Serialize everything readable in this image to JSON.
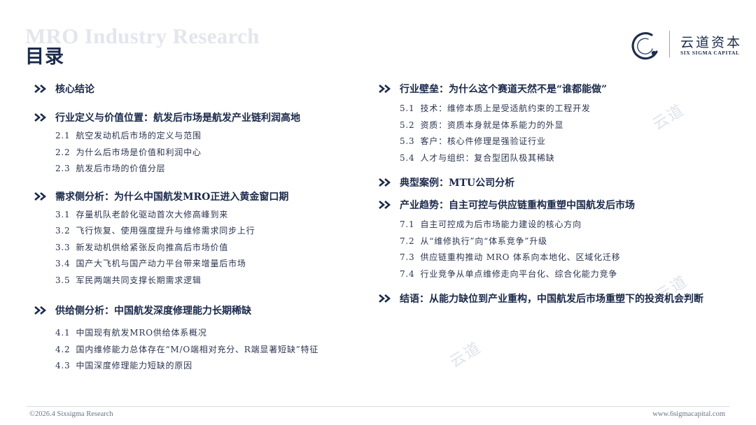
{
  "header": {
    "watermark_title": "MRO Industry Research",
    "title": "目录"
  },
  "logo": {
    "name_cn": "云道资本",
    "name_en": "SIX SIGMA CAPITAL",
    "brand_color": "#1f2d4d",
    "mark_icon": "ring-logo-icon"
  },
  "left_sections": [
    {
      "title": "核心结论",
      "items": []
    },
    {
      "title": "行业定义与价值位置：航发后市场是航发产业链利润高地",
      "items": [
        {
          "num": "2.1",
          "text": "航空发动机后市场的定义与范围"
        },
        {
          "num": "2.2",
          "text": "为什么后市场是价值和利润中心"
        },
        {
          "num": "2.3",
          "text": "航发后市场的价值分层"
        }
      ]
    },
    {
      "title": "需求侧分析：为什么中国航发MRO正进入黄金窗口期",
      "items": [
        {
          "num": "3.1",
          "text": "存量机队老龄化驱动首次大修高峰到来"
        },
        {
          "num": "3.2",
          "text": "飞行恢复、使用强度提升与维修需求同步上行"
        },
        {
          "num": "3.3",
          "text": "新发动机供给紧张反向推高后市场价值"
        },
        {
          "num": "3.4",
          "text": "国产大飞机与国产动力平台带来增量后市场"
        },
        {
          "num": "3.5",
          "text": "军民两端共同支撑长期需求逻辑"
        }
      ]
    },
    {
      "title": "供给侧分析：中国航发深度修理能力长期稀缺",
      "items": [
        {
          "num": "4.1",
          "text": "中国现有航发MRO供给体系概况"
        },
        {
          "num": "4.2",
          "text": "国内维修能力总体存在“M/O端相对充分、R端显著短缺”特征"
        },
        {
          "num": "4.3",
          "text": "中国深度修理能力短缺的原因"
        }
      ]
    }
  ],
  "right_sections": [
    {
      "title": "行业壁垒：为什么这个赛道天然不是“谁都能做”",
      "items": [
        {
          "num": "5.1",
          "text": "技术：维修本质上是受适航约束的工程开发"
        },
        {
          "num": "5.2",
          "text": "资质：资质本身就是体系能力的外显"
        },
        {
          "num": "5.3",
          "text": "客户：核心件修理是强验证行业"
        },
        {
          "num": "5.4",
          "text": "人才与组织：复合型团队极其稀缺"
        }
      ]
    },
    {
      "title": "典型案例：MTU公司分析",
      "items": []
    },
    {
      "title": "产业趋势：自主可控与供应链重构重塑中国航发后市场",
      "items": [
        {
          "num": "7.1",
          "text": "自主可控成为后市场能力建设的核心方向"
        },
        {
          "num": "7.2",
          "text": "从“维修执行”向“体系竞争”升级"
        },
        {
          "num": "7.3",
          "text": "供应链重构推动 MRO 体系向本地化、区域化迁移"
        },
        {
          "num": "7.4",
          "text": "行业竞争从单点维修走向平台化、综合化能力竞争"
        }
      ]
    },
    {
      "title": "结语：从能力缺位到产业重构，中国航发后市场重塑下的投资机会判断",
      "items": []
    }
  ],
  "footer": {
    "copyright": "©2026.4 Sixsigma Research",
    "website": "www.6sigmacapital.com"
  },
  "colors": {
    "heading": "#1b2a4a",
    "watermark": "#e3e6ec"
  }
}
